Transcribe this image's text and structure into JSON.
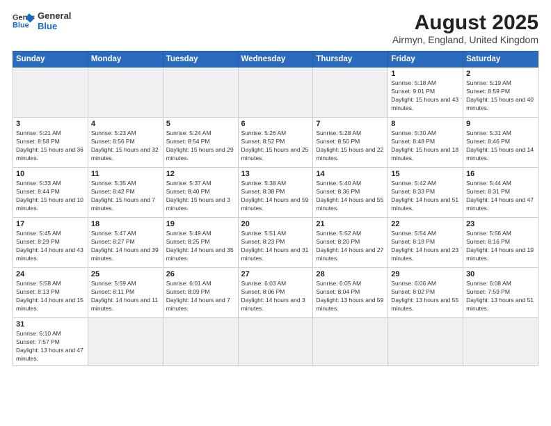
{
  "logo": {
    "line1": "General",
    "line2": "Blue"
  },
  "title": "August 2025",
  "subtitle": "Airmyn, England, United Kingdom",
  "weekdays": [
    "Sunday",
    "Monday",
    "Tuesday",
    "Wednesday",
    "Thursday",
    "Friday",
    "Saturday"
  ],
  "weeks": [
    [
      {
        "day": "",
        "info": ""
      },
      {
        "day": "",
        "info": ""
      },
      {
        "day": "",
        "info": ""
      },
      {
        "day": "",
        "info": ""
      },
      {
        "day": "",
        "info": ""
      },
      {
        "day": "1",
        "info": "Sunrise: 5:18 AM\nSunset: 9:01 PM\nDaylight: 15 hours and 43 minutes."
      },
      {
        "day": "2",
        "info": "Sunrise: 5:19 AM\nSunset: 8:59 PM\nDaylight: 15 hours and 40 minutes."
      }
    ],
    [
      {
        "day": "3",
        "info": "Sunrise: 5:21 AM\nSunset: 8:58 PM\nDaylight: 15 hours and 36 minutes."
      },
      {
        "day": "4",
        "info": "Sunrise: 5:23 AM\nSunset: 8:56 PM\nDaylight: 15 hours and 32 minutes."
      },
      {
        "day": "5",
        "info": "Sunrise: 5:24 AM\nSunset: 8:54 PM\nDaylight: 15 hours and 29 minutes."
      },
      {
        "day": "6",
        "info": "Sunrise: 5:26 AM\nSunset: 8:52 PM\nDaylight: 15 hours and 25 minutes."
      },
      {
        "day": "7",
        "info": "Sunrise: 5:28 AM\nSunset: 8:50 PM\nDaylight: 15 hours and 22 minutes."
      },
      {
        "day": "8",
        "info": "Sunrise: 5:30 AM\nSunset: 8:48 PM\nDaylight: 15 hours and 18 minutes."
      },
      {
        "day": "9",
        "info": "Sunrise: 5:31 AM\nSunset: 8:46 PM\nDaylight: 15 hours and 14 minutes."
      }
    ],
    [
      {
        "day": "10",
        "info": "Sunrise: 5:33 AM\nSunset: 8:44 PM\nDaylight: 15 hours and 10 minutes."
      },
      {
        "day": "11",
        "info": "Sunrise: 5:35 AM\nSunset: 8:42 PM\nDaylight: 15 hours and 7 minutes."
      },
      {
        "day": "12",
        "info": "Sunrise: 5:37 AM\nSunset: 8:40 PM\nDaylight: 15 hours and 3 minutes."
      },
      {
        "day": "13",
        "info": "Sunrise: 5:38 AM\nSunset: 8:38 PM\nDaylight: 14 hours and 59 minutes."
      },
      {
        "day": "14",
        "info": "Sunrise: 5:40 AM\nSunset: 8:36 PM\nDaylight: 14 hours and 55 minutes."
      },
      {
        "day": "15",
        "info": "Sunrise: 5:42 AM\nSunset: 8:33 PM\nDaylight: 14 hours and 51 minutes."
      },
      {
        "day": "16",
        "info": "Sunrise: 5:44 AM\nSunset: 8:31 PM\nDaylight: 14 hours and 47 minutes."
      }
    ],
    [
      {
        "day": "17",
        "info": "Sunrise: 5:45 AM\nSunset: 8:29 PM\nDaylight: 14 hours and 43 minutes."
      },
      {
        "day": "18",
        "info": "Sunrise: 5:47 AM\nSunset: 8:27 PM\nDaylight: 14 hours and 39 minutes."
      },
      {
        "day": "19",
        "info": "Sunrise: 5:49 AM\nSunset: 8:25 PM\nDaylight: 14 hours and 35 minutes."
      },
      {
        "day": "20",
        "info": "Sunrise: 5:51 AM\nSunset: 8:23 PM\nDaylight: 14 hours and 31 minutes."
      },
      {
        "day": "21",
        "info": "Sunrise: 5:52 AM\nSunset: 8:20 PM\nDaylight: 14 hours and 27 minutes."
      },
      {
        "day": "22",
        "info": "Sunrise: 5:54 AM\nSunset: 8:18 PM\nDaylight: 14 hours and 23 minutes."
      },
      {
        "day": "23",
        "info": "Sunrise: 5:56 AM\nSunset: 8:16 PM\nDaylight: 14 hours and 19 minutes."
      }
    ],
    [
      {
        "day": "24",
        "info": "Sunrise: 5:58 AM\nSunset: 8:13 PM\nDaylight: 14 hours and 15 minutes."
      },
      {
        "day": "25",
        "info": "Sunrise: 5:59 AM\nSunset: 8:11 PM\nDaylight: 14 hours and 11 minutes."
      },
      {
        "day": "26",
        "info": "Sunrise: 6:01 AM\nSunset: 8:09 PM\nDaylight: 14 hours and 7 minutes."
      },
      {
        "day": "27",
        "info": "Sunrise: 6:03 AM\nSunset: 8:06 PM\nDaylight: 14 hours and 3 minutes."
      },
      {
        "day": "28",
        "info": "Sunrise: 6:05 AM\nSunset: 8:04 PM\nDaylight: 13 hours and 59 minutes."
      },
      {
        "day": "29",
        "info": "Sunrise: 6:06 AM\nSunset: 8:02 PM\nDaylight: 13 hours and 55 minutes."
      },
      {
        "day": "30",
        "info": "Sunrise: 6:08 AM\nSunset: 7:59 PM\nDaylight: 13 hours and 51 minutes."
      }
    ],
    [
      {
        "day": "31",
        "info": "Sunrise: 6:10 AM\nSunset: 7:57 PM\nDaylight: 13 hours and 47 minutes."
      },
      {
        "day": "",
        "info": ""
      },
      {
        "day": "",
        "info": ""
      },
      {
        "day": "",
        "info": ""
      },
      {
        "day": "",
        "info": ""
      },
      {
        "day": "",
        "info": ""
      },
      {
        "day": "",
        "info": ""
      }
    ]
  ]
}
